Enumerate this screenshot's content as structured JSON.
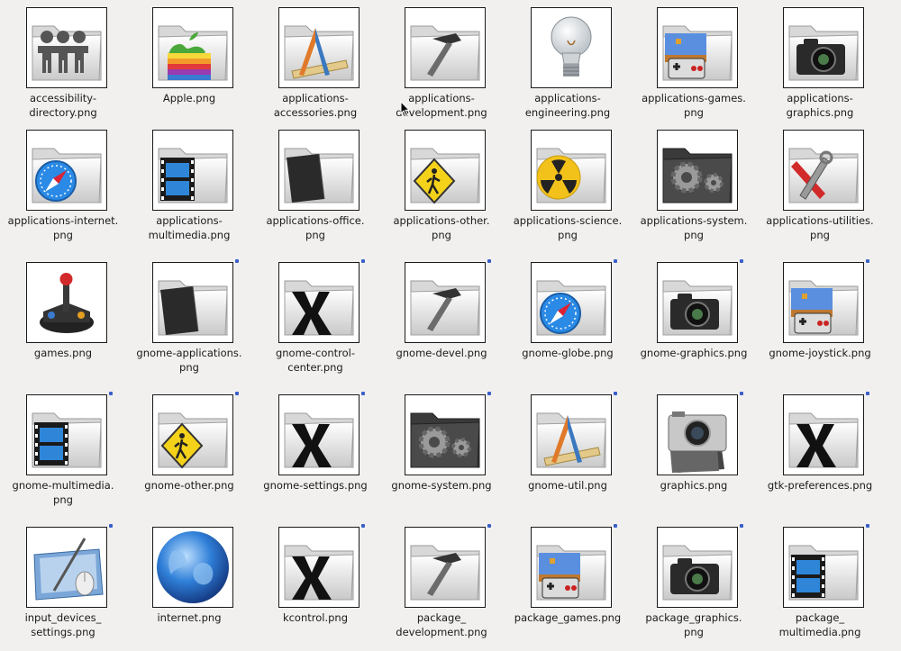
{
  "window_title": "",
  "colors": {
    "background": "#f1f0ef",
    "label_text": "#1a1a1a",
    "thumb_border": "#1a1a1a",
    "link_marker": "#3a5fc8"
  },
  "files": [
    {
      "name": "accessibility-\ndirectory.png",
      "icon": "people-folder-icon",
      "link": false
    },
    {
      "name": "Apple.png",
      "icon": "apple-folder-icon",
      "link": false
    },
    {
      "name": "applications-\naccessories.png",
      "icon": "drafting-tools-folder-icon",
      "link": false
    },
    {
      "name": "applications-\ndevelopment.png",
      "icon": "hammer-folder-icon",
      "link": false
    },
    {
      "name": "applications-\nengineering.png",
      "icon": "lightbulb-icon",
      "link": false
    },
    {
      "name": "applications-games.\npng",
      "icon": "game-controller-folder-icon",
      "link": false
    },
    {
      "name": "applications-\ngraphics.png",
      "icon": "camera-folder-icon",
      "link": false
    },
    {
      "name": "applications-internet.\npng",
      "icon": "compass-folder-icon",
      "link": false
    },
    {
      "name": "applications-\nmultimedia.png",
      "icon": "film-folder-icon",
      "link": false
    },
    {
      "name": "applications-office.\npng",
      "icon": "document-folder-icon",
      "link": false
    },
    {
      "name": "applications-other.\npng",
      "icon": "pedestrian-sign-folder-icon",
      "link": false
    },
    {
      "name": "applications-science.\npng",
      "icon": "radiation-folder-icon",
      "link": false
    },
    {
      "name": "applications-system.\npng",
      "icon": "gears-folder-icon",
      "link": false
    },
    {
      "name": "applications-utilities.\npng",
      "icon": "tools-folder-icon",
      "link": false
    },
    {
      "name": "games.png",
      "icon": "joystick-icon",
      "link": false
    },
    {
      "name": "gnome-applications.\npng",
      "icon": "document-folder-icon",
      "link": true
    },
    {
      "name": "gnome-control-\ncenter.png",
      "icon": "x-folder-icon",
      "link": true
    },
    {
      "name": "gnome-devel.png",
      "icon": "hammer-folder-icon",
      "link": true
    },
    {
      "name": "gnome-globe.png",
      "icon": "compass-folder-icon",
      "link": true
    },
    {
      "name": "gnome-graphics.png",
      "icon": "camera-folder-icon",
      "link": true
    },
    {
      "name": "gnome-joystick.png",
      "icon": "game-controller-folder-icon",
      "link": true
    },
    {
      "name": "gnome-multimedia.\npng",
      "icon": "film-folder-icon",
      "link": true
    },
    {
      "name": "gnome-other.png",
      "icon": "pedestrian-sign-folder-icon",
      "link": true
    },
    {
      "name": "gnome-settings.png",
      "icon": "x-folder-icon",
      "link": true
    },
    {
      "name": "gnome-system.png",
      "icon": "gears-folder-icon",
      "link": true
    },
    {
      "name": "gnome-util.png",
      "icon": "drafting-tools-folder-icon",
      "link": true
    },
    {
      "name": "graphics.png",
      "icon": "photo-camera-icon",
      "link": true
    },
    {
      "name": "gtk-preferences.png",
      "icon": "x-folder-icon",
      "link": true
    },
    {
      "name": "input_devices_\nsettings.png",
      "icon": "tablet-mouse-icon",
      "link": true
    },
    {
      "name": "internet.png",
      "icon": "globe-icon",
      "link": false
    },
    {
      "name": "kcontrol.png",
      "icon": "x-folder-icon",
      "link": true
    },
    {
      "name": "package_\ndevelopment.png",
      "icon": "hammer-folder-icon",
      "link": true
    },
    {
      "name": "package_games.png",
      "icon": "game-controller-folder-icon",
      "link": true
    },
    {
      "name": "package_graphics.\npng",
      "icon": "camera-folder-icon",
      "link": true
    },
    {
      "name": "package_\nmultimedia.png",
      "icon": "film-folder-icon",
      "link": true
    }
  ]
}
